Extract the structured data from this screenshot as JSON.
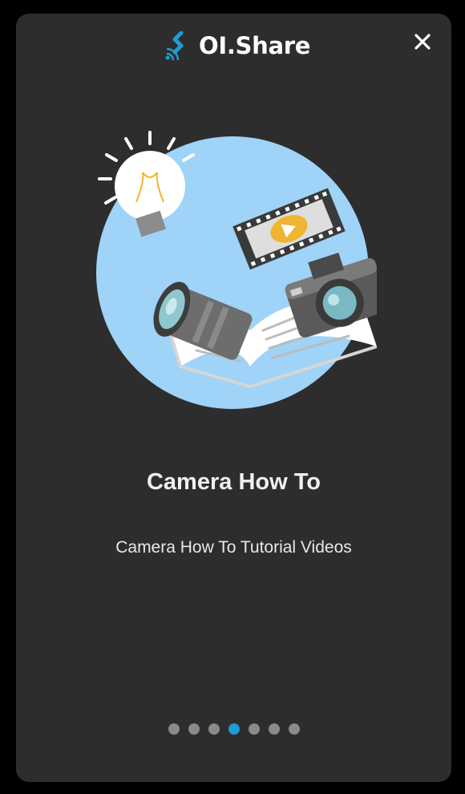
{
  "app": {
    "logo_text": "OI.Share",
    "logo_icon": "oishare-logo-icon",
    "close_icon": "close-icon"
  },
  "slide": {
    "title": "Camera How To",
    "subtitle": "Camera How To Tutorial Videos",
    "illustration": "camera-how-to-illustration"
  },
  "pagination": {
    "total": 7,
    "active_index": 3
  },
  "colors": {
    "background": "#000000",
    "card": "#2d2d2d",
    "accent": "#1e9bd7",
    "dot_inactive": "#8a8a8a",
    "illustration_circle": "#9fd3f7"
  }
}
